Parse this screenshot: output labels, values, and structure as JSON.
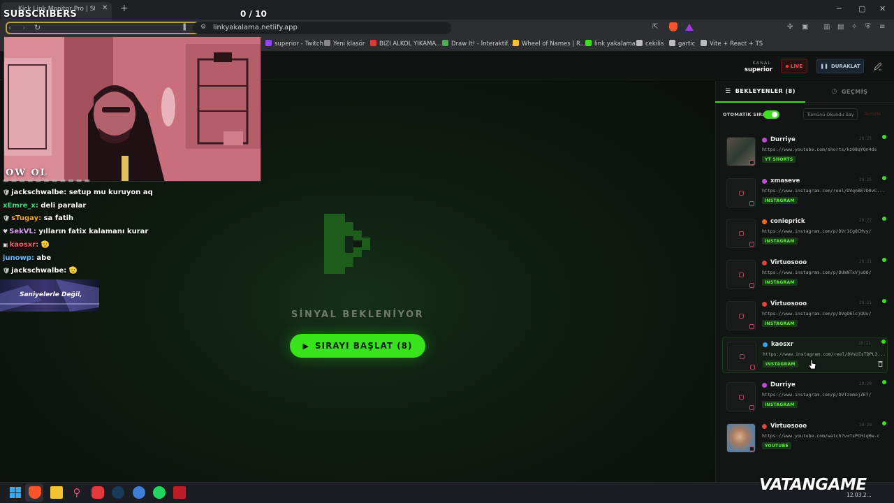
{
  "browser": {
    "tab_title": "Kick Link Monitor Pro | Stream D",
    "url": "linkyakalama.netlify.app",
    "bookmarks": [
      {
        "label": "superior - Twitch",
        "color": "#9146ff"
      },
      {
        "label": "Yeni klasör",
        "color": "#888888"
      },
      {
        "label": "BIZI ALKOL YIKAMA...",
        "color": "#e53935"
      },
      {
        "label": "Draw It! - İnteraktif...",
        "color": "#4caf50"
      },
      {
        "label": "Wheel of Names | R...",
        "color": "#fbc02d"
      },
      {
        "label": "link yakalama",
        "color": "#38e31c"
      },
      {
        "label": "cekilis",
        "color": "#bbbbbb"
      },
      {
        "label": "gartic",
        "color": "#bbbbbb"
      },
      {
        "label": "Vite + React + TS",
        "color": "#bbbbbb"
      }
    ]
  },
  "overlay": {
    "subscribers_label": "SUBSCRIBERS",
    "subscribers_count": "0  / 10",
    "cam_label": "OW OL",
    "chat": [
      {
        "user": "jackschwalbe",
        "color": "#ffffff",
        "badge": "🛡",
        "text": "setup mu kuruyon aq"
      },
      {
        "user": "xEmre_x",
        "color": "#3ddc84",
        "badge": "",
        "text": "deli paralar"
      },
      {
        "user": "sTugay",
        "color": "#f5a623",
        "badge": "🛡",
        "text": "sa fatih"
      },
      {
        "user": "SekVL",
        "color": "#e0a0ff",
        "badge": "♥",
        "text": "yılların fatix kalamanı kurar"
      },
      {
        "user": "kaosxr",
        "color": "#ff5a6e",
        "badge": "▣",
        "text": "🫡"
      },
      {
        "user": "junowp",
        "color": "#6ab6ff",
        "badge": "",
        "text": "abe"
      },
      {
        "user": "jackschwalbe",
        "color": "#ffffff",
        "badge": "🛡",
        "text": "🫡"
      }
    ],
    "banner_text": "Saniyelerle Değil,"
  },
  "header": {
    "kanal_label": "KANAL",
    "kanal_value": "superior",
    "live_label": "LIVE",
    "pause_label": "DURAKLAT"
  },
  "stage": {
    "signal_text": "SİNYAL BEKLENİYOR",
    "start_label": "SIRAYI BAŞLAT (8)"
  },
  "sidebar": {
    "tab_waiting": "BEKLEYENLER (8)",
    "tab_history": "GEÇMİŞ",
    "auto_label": "OTOMATİK SIRA",
    "auto_on": true,
    "mark_read_label": "Tümünü Okundu Say",
    "clear_label": "Temizle",
    "cards": [
      {
        "user": "Durriye",
        "time": "20:25",
        "url": "https://www.youtube.com/shorts/kz08qYQn4ds",
        "tag": "YT SHORTS",
        "dot": "#c14bd6",
        "thumb": "video"
      },
      {
        "user": "xmaseve",
        "time": "20:25",
        "url": "https://www.instagram.com/reel/DVqnBE7D0vC...",
        "tag": "INSTAGRAM",
        "dot": "#c14bd6",
        "thumb": "ig"
      },
      {
        "user": "conieprick",
        "time": "20:22",
        "url": "https://www.instagram.com/p/DVr1Cg8CMvy/",
        "tag": "INSTAGRAM",
        "dot": "#f06a1c",
        "thumb": "ig"
      },
      {
        "user": "Virtuosooo",
        "time": "20:21",
        "url": "https://www.instagram.com/p/DUmNTxVjuOO/",
        "tag": "INSTAGRAM",
        "dot": "#e0453a",
        "thumb": "ig"
      },
      {
        "user": "Virtuosooo",
        "time": "20:21",
        "url": "https://www.instagram.com/p/DVgO6lcjQUu/",
        "tag": "INSTAGRAM",
        "dot": "#e0453a",
        "thumb": "ig"
      },
      {
        "user": "kaosxr",
        "time": "20:21",
        "url": "https://www.instagram.com/reel/DVsUIsTDPL3...",
        "tag": "INSTAGRAM",
        "dot": "#3aa0e0",
        "thumb": "ig",
        "active": true
      },
      {
        "user": "Durriye",
        "time": "20:20",
        "url": "https://www.instagram.com/p/DVTzomojZE7/",
        "tag": "INSTAGRAM",
        "dot": "#c14bd6",
        "thumb": "ig"
      },
      {
        "user": "Virtuosooo",
        "time": "20:20",
        "url": "https://www.youtube.com/watch?v=TsPCHiqHw-c",
        "tag": "YOUTUBE",
        "dot": "#e0453a",
        "thumb": "face"
      }
    ]
  },
  "taskbar": {
    "brand": "VATANGAME",
    "clock": "12.03.2..."
  }
}
